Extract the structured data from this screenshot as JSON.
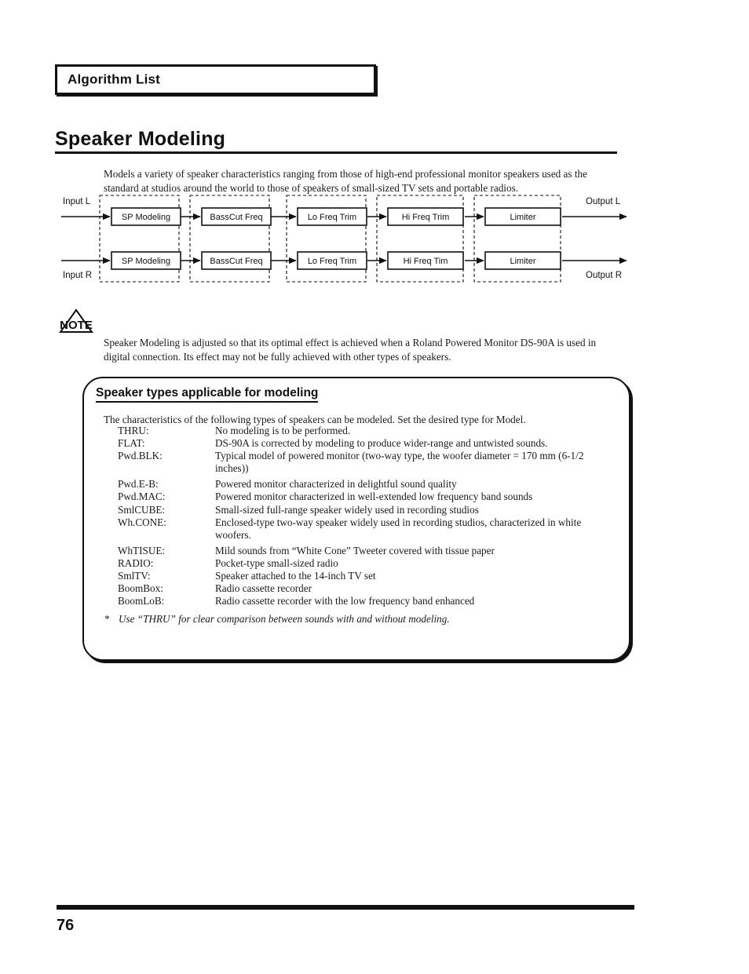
{
  "header": {
    "box_label": "Algorithm List"
  },
  "section": {
    "title": "Speaker Modeling",
    "intro": "Models a variety of speaker characteristics ranging from those of high-end professional monitor speakers used as the standard at studios around the world to those of speakers of small-sized TV sets and portable radios."
  },
  "diagram": {
    "input_left_label": "Input L",
    "input_right_label": "Input R",
    "output_left_label": "Output L",
    "output_right_label": "Output R",
    "top_chain": [
      "SP Modeling",
      "BassCut Freq",
      "Lo Freq Trim",
      "Hi Freq Trim",
      "Limiter"
    ],
    "bottom_chain": [
      "SP Modeling",
      "BassCut Freq",
      "Lo Freq Trim",
      "Hi Freq Tim",
      "Limiter"
    ]
  },
  "note": {
    "icon_label": "NOTE",
    "text": "Speaker Modeling is adjusted so that its optimal effect is achieved when a Roland Powered Monitor DS-90A is used in digital connection. Its effect may not be fully achieved with other types of speakers."
  },
  "types_panel": {
    "heading": "Speaker types applicable for modeling",
    "subtitle": "The characteristics of the following types of speakers can be modeled. Set the desired type for Model.",
    "items": [
      {
        "term": "THRU:",
        "desc": "No modeling is to be performed."
      },
      {
        "term": "FLAT:",
        "desc": "DS-90A is corrected by modeling to produce wider-range and untwisted sounds."
      },
      {
        "term": "Pwd.BLK:",
        "desc": "Typical model of powered monitor (two-way type, the woofer diameter = 170 mm (6-1/2 inches))"
      },
      {
        "term": "Pwd.E-B:",
        "desc": "Powered monitor characterized in delightful sound quality"
      },
      {
        "term": "Pwd.MAC:",
        "desc": "Powered monitor characterized in well-extended low frequency band sounds"
      },
      {
        "term": "SmlCUBE:",
        "desc": "Small-sized full-range speaker widely used in recording studios"
      },
      {
        "term": "Wh.CONE:",
        "desc": "Enclosed-type two-way speaker widely used in recording studios, characterized in white woofers."
      },
      {
        "term": "WhTISUE:",
        "desc": "Mild sounds from “White Cone” Tweeter covered with tissue paper"
      },
      {
        "term": "RADIO:",
        "desc": "Pocket-type small-sized radio"
      },
      {
        "term": "SmlTV:",
        "desc": "Speaker attached to the 14-inch TV set"
      },
      {
        "term": "BoomBox:",
        "desc": "Radio cassette recorder"
      },
      {
        "term": "BoomLoB:",
        "desc": "Radio cassette recorder with the low frequency band enhanced"
      }
    ],
    "footnote_marker": "*",
    "footnote": "Use “THRU” for clear comparison between sounds with and without modeling."
  },
  "footer": {
    "page_number": "76"
  }
}
